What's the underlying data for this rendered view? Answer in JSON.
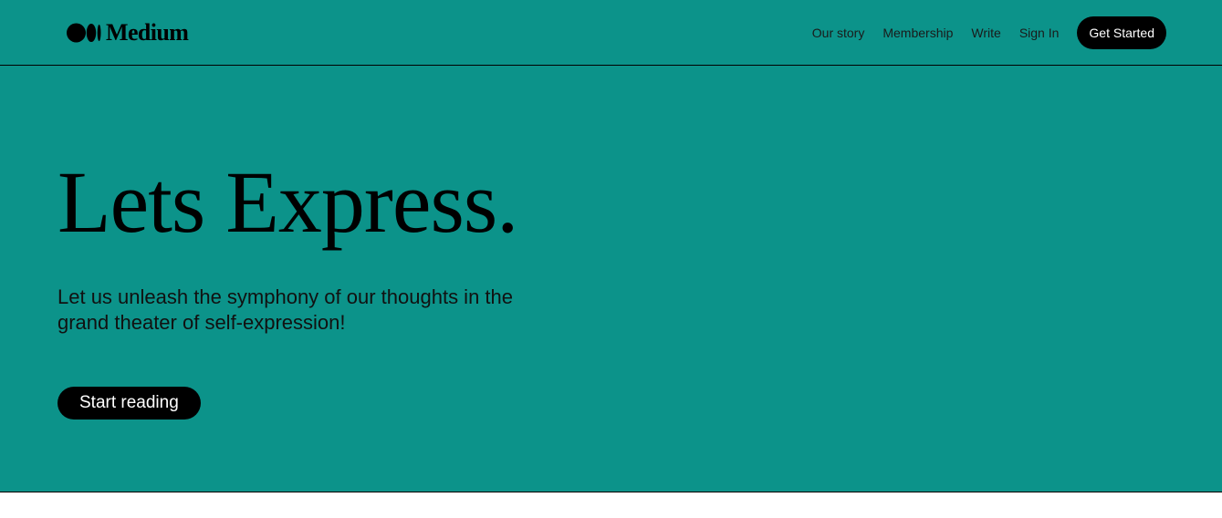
{
  "header": {
    "brand": {
      "name": "Medium",
      "icon": "medium-logo-icon"
    },
    "nav": {
      "our_story": "Our story",
      "membership": "Membership",
      "write": "Write",
      "sign_in": "Sign In",
      "get_started": "Get Started"
    }
  },
  "hero": {
    "title": "Lets Express.",
    "subtitle": "Let us unleash the symphony of our thoughts in the grand theater of self-expression!",
    "cta": "Start reading"
  },
  "colors": {
    "background": "#0c938a",
    "button": "#000000",
    "button_text": "#ffffff"
  }
}
